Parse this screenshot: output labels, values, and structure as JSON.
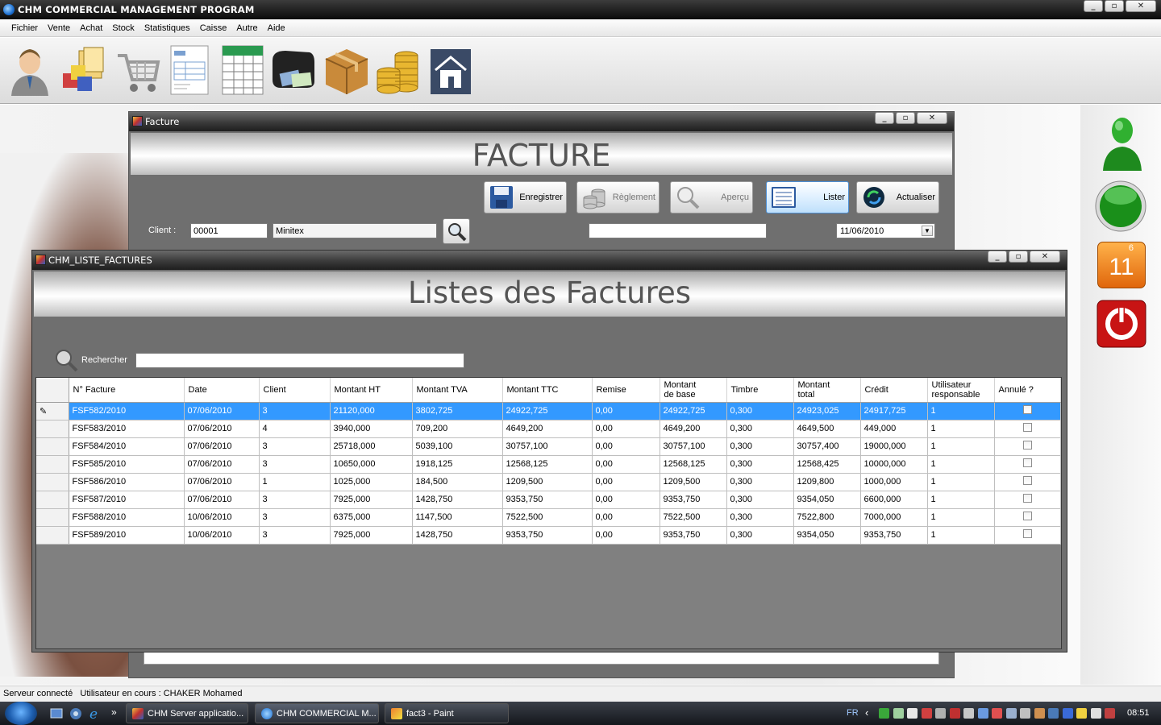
{
  "app": {
    "title": "CHM COMMERCIAL MANAGEMENT PROGRAM",
    "window_buttons": {
      "minimize": "_",
      "maximize": "▫",
      "close": "✕"
    }
  },
  "menu": [
    "Fichier",
    "Vente",
    "Achat",
    "Stock",
    "Statistiques",
    "Caisse",
    "Autre",
    "Aide"
  ],
  "toolbar_icons": [
    "user-icon",
    "products-icon",
    "cart-icon",
    "document-icon",
    "spreadsheet-icon",
    "wallet-icon",
    "box-icon",
    "coins-icon",
    "home-icon"
  ],
  "facture_window": {
    "title": "Facture",
    "heading": "FACTURE",
    "buttons": {
      "save": "Enregistrer",
      "payment": "Règlement",
      "preview": "Aperçu",
      "list": "Lister",
      "refresh": "Actualiser"
    },
    "client_label": "Client :",
    "client_code": "00001",
    "client_name": "Minitex",
    "date": "11/06/2010",
    "extra_field": ""
  },
  "liste_window": {
    "title": "CHM_LISTE_FACTURES",
    "heading": "Listes des Factures",
    "search_label": "Rechercher",
    "search_value": "",
    "columns": [
      "N° Facture",
      "Date",
      "Client",
      "Montant HT",
      "Montant TVA",
      "Montant TTC",
      "Remise",
      "Montant\nde base",
      "Timbre",
      "Montant\ntotal",
      "Crédit",
      "Utilisateur\nresponsable",
      "Annulé ?"
    ],
    "rows": [
      [
        "FSF582/2010",
        "07/06/2010",
        "3",
        "21120,000",
        "3802,725",
        "24922,725",
        "0,00",
        "24922,725",
        "0,300",
        "24923,025",
        "24917,725",
        "1"
      ],
      [
        "FSF583/2010",
        "07/06/2010",
        "4",
        "3940,000",
        "709,200",
        "4649,200",
        "0,00",
        "4649,200",
        "0,300",
        "4649,500",
        "449,000",
        "1"
      ],
      [
        "FSF584/2010",
        "07/06/2010",
        "3",
        "25718,000",
        "5039,100",
        "30757,100",
        "0,00",
        "30757,100",
        "0,300",
        "30757,400",
        "19000,000",
        "1"
      ],
      [
        "FSF585/2010",
        "07/06/2010",
        "3",
        "10650,000",
        "1918,125",
        "12568,125",
        "0,00",
        "12568,125",
        "0,300",
        "12568,425",
        "10000,000",
        "1"
      ],
      [
        "FSF586/2010",
        "07/06/2010",
        "1",
        "1025,000",
        "184,500",
        "1209,500",
        "0,00",
        "1209,500",
        "0,300",
        "1209,800",
        "1000,000",
        "1"
      ],
      [
        "FSF587/2010",
        "07/06/2010",
        "3",
        "7925,000",
        "1428,750",
        "9353,750",
        "0,00",
        "9353,750",
        "0,300",
        "9354,050",
        "6600,000",
        "1"
      ],
      [
        "FSF588/2010",
        "10/06/2010",
        "3",
        "6375,000",
        "1147,500",
        "7522,500",
        "0,00",
        "7522,500",
        "0,300",
        "7522,800",
        "7000,000",
        "1"
      ],
      [
        "FSF589/2010",
        "10/06/2010",
        "3",
        "7925,000",
        "1428,750",
        "9353,750",
        "0,00",
        "9353,750",
        "0,300",
        "9354,050",
        "9353,750",
        "1"
      ]
    ],
    "selected_row": 0,
    "row_marker": "✎"
  },
  "side_panel": {
    "calendar_month": "6",
    "calendar_day": "11"
  },
  "status_bar": "Serveur connecté   Utilisateur en cours : CHAKER Mohamed",
  "taskbar": {
    "items": [
      "CHM Server applicatio...",
      "CHM COMMERCIAL M...",
      "fact3 - Paint"
    ],
    "language": "FR",
    "clock": "08:51",
    "quicklaunch_more": "»",
    "tray_arrow": "‹"
  },
  "colors": {
    "selection": "#3399ff",
    "window_bg": "#6f6f6f"
  }
}
